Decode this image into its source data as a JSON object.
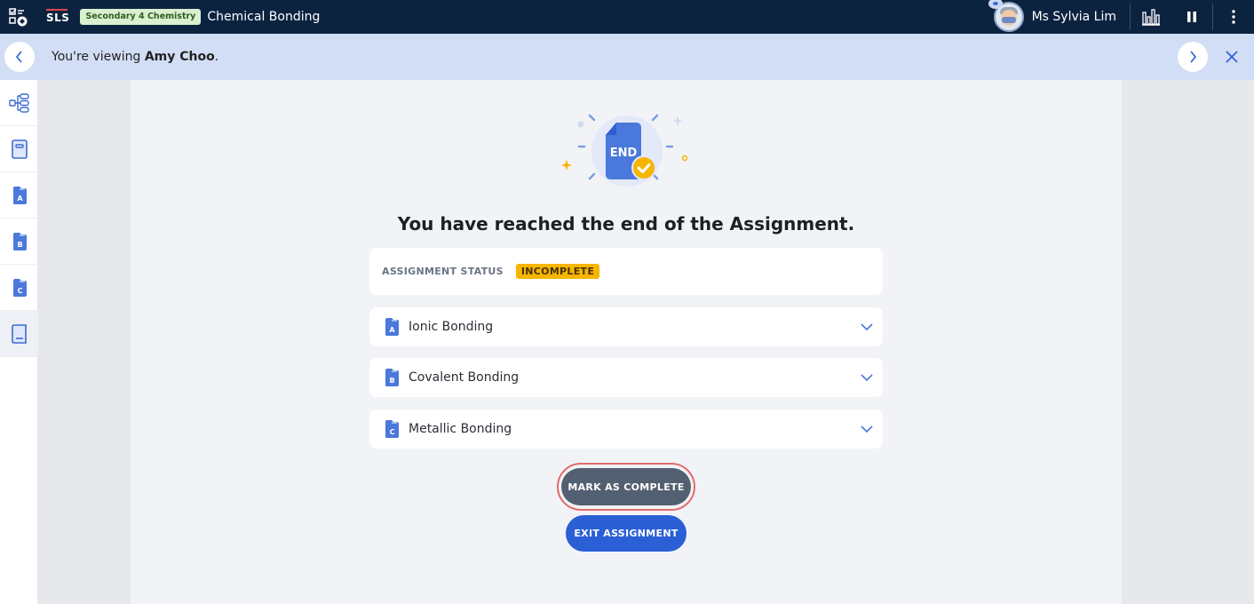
{
  "topbar": {
    "logo": "SLS",
    "subject_badge": "Secondary 4 Chemistry",
    "title": "Chemical Bonding",
    "user_name": "Ms Sylvia Lim",
    "icons": [
      "menu-checklist-icon",
      "avatar",
      "bar-chart-icon",
      "pause-icon",
      "more-vertical-icon"
    ]
  },
  "banner": {
    "prefix": "You're viewing ",
    "student": "Amy Choo",
    "suffix": "."
  },
  "sidebar": {
    "items": [
      {
        "icon": "tree-structure-icon",
        "active": false
      },
      {
        "icon": "notebook-icon",
        "active": false
      },
      {
        "icon": "folder-a-icon",
        "letter": "A",
        "active": false
      },
      {
        "icon": "folder-b-icon",
        "letter": "B",
        "active": false
      },
      {
        "icon": "folder-c-icon",
        "letter": "C",
        "active": false
      },
      {
        "icon": "book-end-icon",
        "active": true
      }
    ]
  },
  "main": {
    "illustration_text": "END",
    "heading": "You have reached the end of the Assignment.",
    "status_label": "ASSIGNMENT STATUS",
    "status_value": "INCOMPLETE",
    "sections": [
      {
        "letter": "A",
        "title": "Ionic Bonding"
      },
      {
        "letter": "B",
        "title": "Covalent Bonding"
      },
      {
        "letter": "C",
        "title": "Metallic Bonding"
      }
    ],
    "mark_complete_label": "MARK AS COMPLETE",
    "exit_label": "EXIT ASSIGNMENT"
  },
  "colors": {
    "topbar_bg": "#0c2340",
    "banner_bg": "#d2def5",
    "accent_blue": "#2a5fd6",
    "status_yellow": "#f7b500",
    "mark_button": "#536072",
    "highlight_ring": "#e26a6a"
  }
}
